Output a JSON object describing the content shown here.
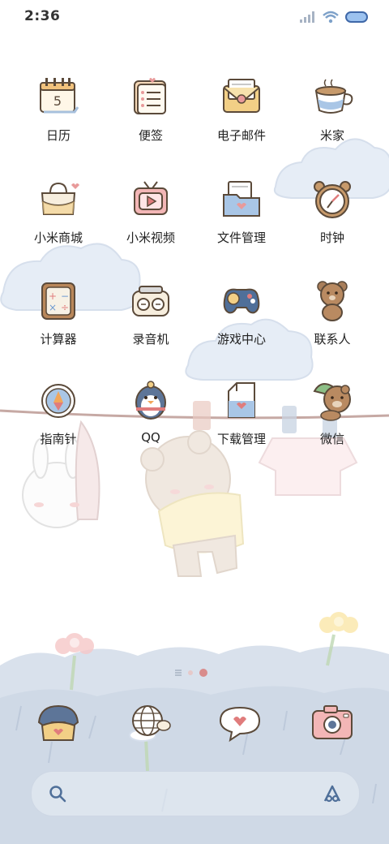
{
  "status_bar": {
    "time": "2:36"
  },
  "apps": [
    {
      "name": "calendar",
      "label": "日历",
      "icon": "calendar-icon",
      "day": "5"
    },
    {
      "name": "notes",
      "label": "便签",
      "icon": "notes-icon"
    },
    {
      "name": "email",
      "label": "电子邮件",
      "icon": "email-icon"
    },
    {
      "name": "mi-home",
      "label": "米家",
      "icon": "coffee-cup-icon"
    },
    {
      "name": "mi-store",
      "label": "小米商城",
      "icon": "shopping-bag-icon"
    },
    {
      "name": "mi-video",
      "label": "小米视频",
      "icon": "tv-icon"
    },
    {
      "name": "file-manager",
      "label": "文件管理",
      "icon": "folder-icon"
    },
    {
      "name": "clock",
      "label": "时钟",
      "icon": "alarm-clock-icon"
    },
    {
      "name": "calculator",
      "label": "计算器",
      "icon": "calculator-icon"
    },
    {
      "name": "recorder",
      "label": "录音机",
      "icon": "radio-icon"
    },
    {
      "name": "game-center",
      "label": "游戏中心",
      "icon": "gamepad-icon"
    },
    {
      "name": "contacts",
      "label": "联系人",
      "icon": "bear-icon"
    },
    {
      "name": "compass",
      "label": "指南针",
      "icon": "compass-icon"
    },
    {
      "name": "qq",
      "label": "QQ",
      "icon": "penguin-icon"
    },
    {
      "name": "downloads",
      "label": "下载管理",
      "icon": "milk-carton-icon"
    },
    {
      "name": "wechat",
      "label": "微信",
      "icon": "bear-with-hat-icon"
    }
  ],
  "dock": [
    {
      "name": "phone",
      "icon": "phone-icon"
    },
    {
      "name": "browser",
      "icon": "globe-icon"
    },
    {
      "name": "messages",
      "icon": "chat-heart-icon"
    },
    {
      "name": "camera",
      "icon": "camera-icon"
    }
  ],
  "pager": {
    "pages": 2,
    "active": 2
  },
  "colors": {
    "accent": "#d98c8c",
    "text": "#222222",
    "sky": "#dfe7f2"
  }
}
